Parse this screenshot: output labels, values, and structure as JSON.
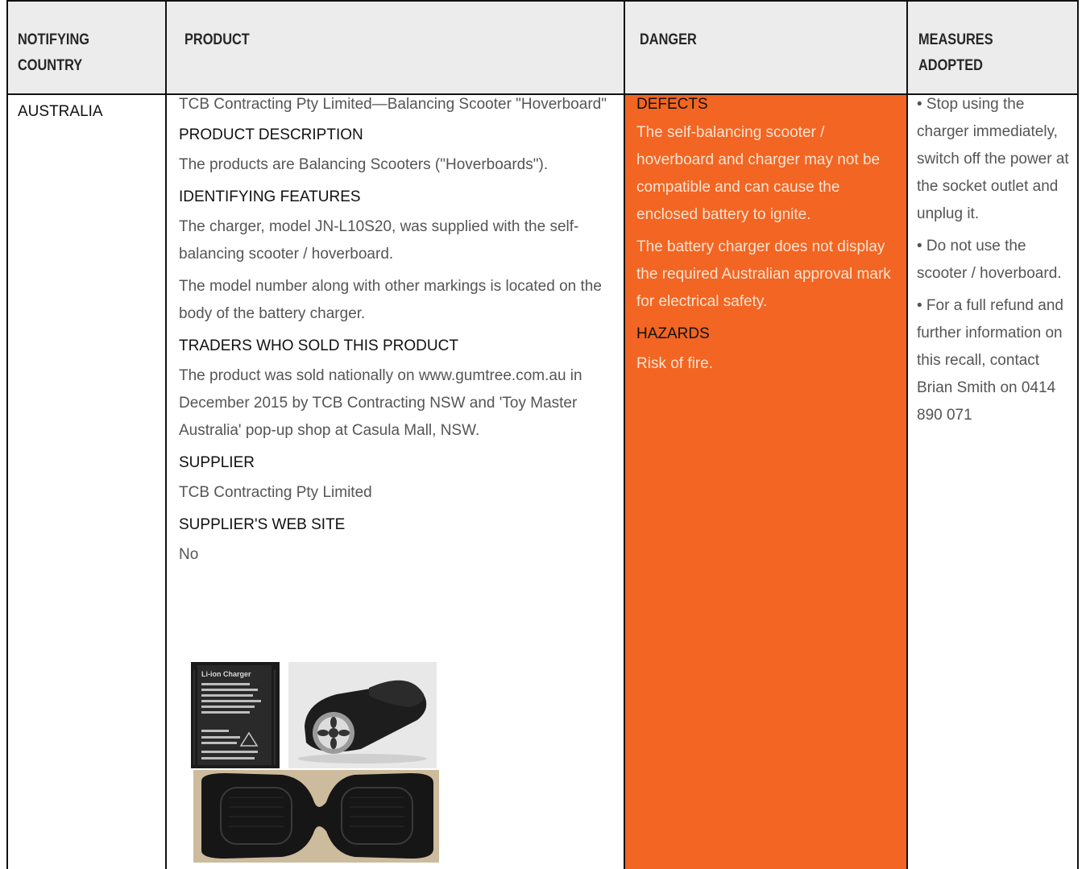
{
  "table": {
    "headers": {
      "country_line1": "NOTIFYING",
      "country_line2": "COUNTRY",
      "product": "PRODUCT",
      "danger": "DANGER",
      "measures_line1": "MEASURES",
      "measures_line2": "ADOPTED"
    },
    "row": {
      "country": "AUSTRALIA",
      "product": {
        "title": "TCB Contracting Pty Limited—Balancing Scooter \"Hoverboard\"",
        "description_heading": "PRODUCT DESCRIPTION",
        "description": "The products are Balancing Scooters (\"Hoverboards\").",
        "features_heading": "IDENTIFYING FEATURES",
        "features_1": "The charger, model JN-L10S20, was supplied with the self-balancing scooter / hoverboard.",
        "features_2": "The model number along with other markings is located on the body of the battery charger.",
        "traders_heading": "TRADERS WHO SOLD THIS PRODUCT",
        "traders": "The product was sold nationally on www.gumtree.com.au in December 2015 by TCB Contracting NSW and 'Toy Master Australia' pop-up shop at Casula Mall, NSW.",
        "supplier_heading": "SUPPLIER",
        "supplier": "TCB Contracting Pty Limited",
        "website_heading": "SUPPLIER'S WEB SITE",
        "website": "No",
        "label_text": "Li-ion Charger"
      },
      "danger": {
        "defects_heading": "DEFECTS",
        "defects_1": "The self-balancing scooter / hoverboard and charger may not be compatible and can cause the enclosed battery to ignite.",
        "defects_2": "The battery charger does not display the required Australian approval mark for electrical safety.",
        "hazards_heading": "HAZARDS",
        "hazards": "Risk of fire."
      },
      "measures": {
        "item_1": "• Stop using the charger immediately, switch off the power at the socket outlet and unplug it.",
        "item_2": "• Do not use the scooter / hoverboard.",
        "item_3": "• For a full refund and further information on this recall, contact Brian Smith on 0414 890 071"
      }
    },
    "colors": {
      "header_bg": "#ececec",
      "danger_bg": "#f26522",
      "danger_text": "#fde3d2",
      "body_text": "#555555"
    }
  }
}
